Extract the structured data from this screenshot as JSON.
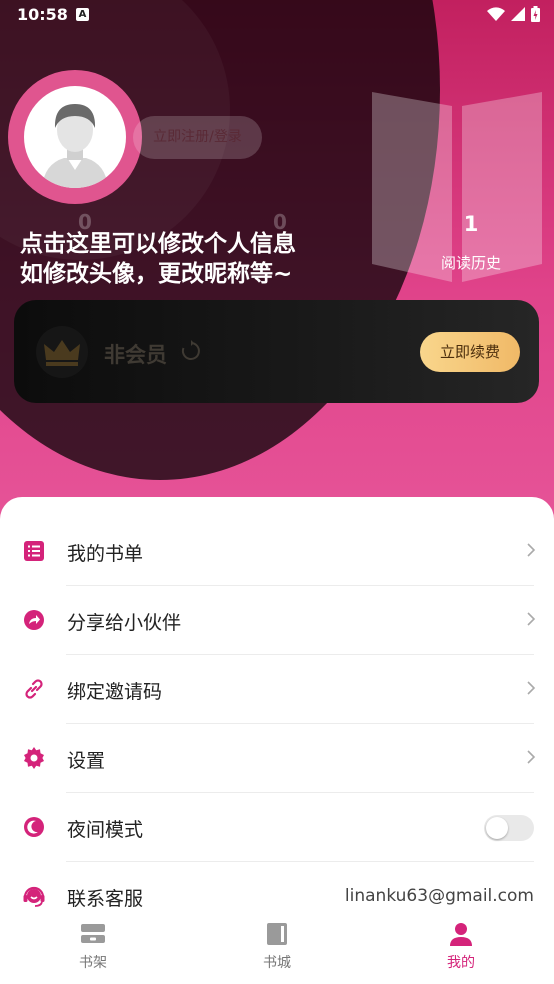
{
  "status_bar": {
    "time": "10:58",
    "notification": "A"
  },
  "profile": {
    "login_label": "立即注册/登录",
    "stats": [
      {
        "value": "0"
      },
      {
        "value": "0"
      }
    ],
    "history": {
      "count": "1",
      "label": "阅读历史"
    },
    "tip_line1": "点击这里可以修改个人信息",
    "tip_line2": "如修改头像，更改昵称等~"
  },
  "vip": {
    "status": "非会员",
    "renew_label": "立即续费"
  },
  "menu": {
    "items": [
      {
        "label": "我的书单",
        "icon": "list-icon"
      },
      {
        "label": "分享给小伙伴",
        "icon": "share-icon"
      },
      {
        "label": "绑定邀请码",
        "icon": "link-icon"
      },
      {
        "label": "设置",
        "icon": "gear-icon"
      },
      {
        "label": "夜间模式",
        "icon": "moon-icon",
        "toggle": false
      },
      {
        "label": "联系客服",
        "icon": "headset-icon",
        "value": "linanku63@gmail.com"
      }
    ]
  },
  "nav": {
    "items": [
      {
        "label": "书架",
        "icon": "bookshelf-icon"
      },
      {
        "label": "书城",
        "icon": "book-icon"
      },
      {
        "label": "我的",
        "icon": "person-icon",
        "active": true
      }
    ]
  },
  "colors": {
    "accent": "#d4237a",
    "hero": "#e0438a",
    "gold": "#f0b967"
  }
}
